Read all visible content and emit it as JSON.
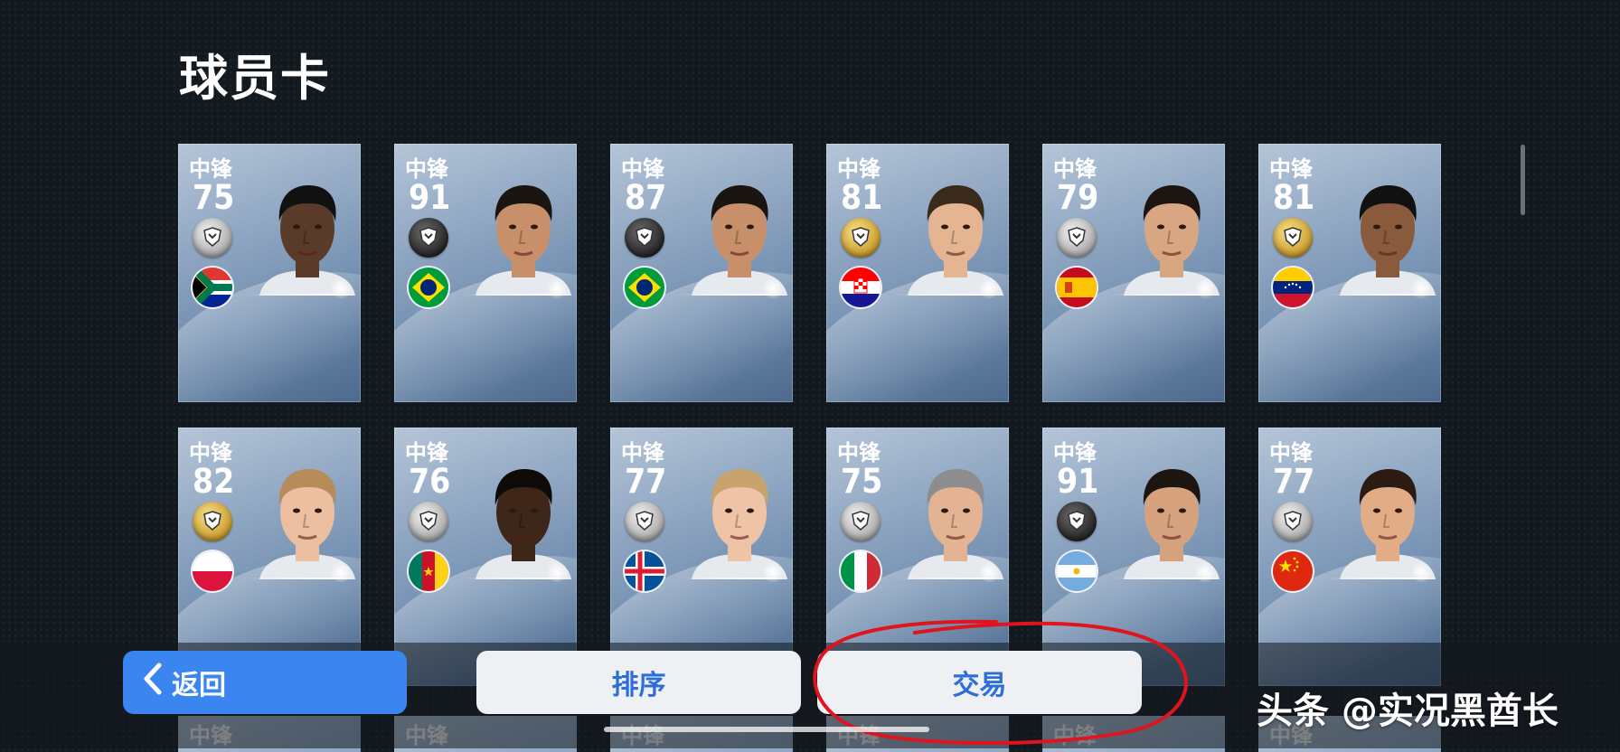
{
  "page": {
    "title": "球员卡"
  },
  "cards": [
    {
      "position": "中锋",
      "rating": "75",
      "medal": "silver",
      "flag": "south-africa",
      "skin": "#5a3a28",
      "hair": "#111"
    },
    {
      "position": "中锋",
      "rating": "91",
      "medal": "black",
      "flag": "brazil",
      "skin": "#c8906a",
      "hair": "#1b1511"
    },
    {
      "position": "中锋",
      "rating": "87",
      "medal": "black",
      "flag": "brazil",
      "skin": "#c8906a",
      "hair": "#1b1511"
    },
    {
      "position": "中锋",
      "rating": "81",
      "medal": "gold",
      "flag": "croatia",
      "skin": "#e5b592",
      "hair": "#3a2a1c"
    },
    {
      "position": "中锋",
      "rating": "79",
      "medal": "silver",
      "flag": "spain",
      "skin": "#d8a680",
      "hair": "#1d150f"
    },
    {
      "position": "中锋",
      "rating": "81",
      "medal": "gold",
      "flag": "venezuela",
      "skin": "#8a5a3c",
      "hair": "#111"
    },
    {
      "position": "中锋",
      "rating": "82",
      "medal": "gold",
      "flag": "poland",
      "skin": "#ecbfa0",
      "hair": "#b58c5a"
    },
    {
      "position": "中锋",
      "rating": "76",
      "medal": "silver",
      "flag": "cameroon",
      "skin": "#3e2619",
      "hair": "#0e0a08"
    },
    {
      "position": "中锋",
      "rating": "77",
      "medal": "silver",
      "flag": "iceland",
      "skin": "#efc4a6",
      "hair": "#c9a36e"
    },
    {
      "position": "中锋",
      "rating": "75",
      "medal": "silver",
      "flag": "italy",
      "skin": "#e3b393",
      "hair": "#8d8d8d"
    },
    {
      "position": "中锋",
      "rating": "91",
      "medal": "black",
      "flag": "argentina",
      "skin": "#d6a27d",
      "hair": "#1c1510"
    },
    {
      "position": "中锋",
      "rating": "77",
      "medal": "silver",
      "flag": "china",
      "skin": "#e2ac86",
      "hair": "#2b1b12"
    }
  ],
  "third_row": [
    "中锋",
    "中锋",
    "中锋",
    "中锋",
    "中锋",
    "中锋"
  ],
  "buttons": {
    "back": "返回",
    "sort": "排序",
    "trade": "交易"
  },
  "watermark": "头条 @实况黑酋长",
  "colors": {
    "back_button": "#3a85f0",
    "button_text": "#2d6fd6",
    "annotation": "#e0141e"
  }
}
